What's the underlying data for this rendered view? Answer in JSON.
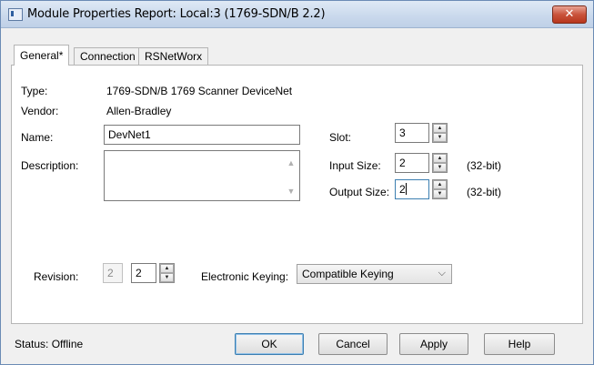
{
  "window": {
    "title": "Module Properties Report: Local:3 (1769-SDN/B 2.2)",
    "close_glyph": "✕"
  },
  "tabs": [
    {
      "label": "General*",
      "active": true
    },
    {
      "label": "Connection",
      "active": false
    },
    {
      "label": "RSNetWorx",
      "active": false
    }
  ],
  "general": {
    "type_label": "Type:",
    "type_value": "1769-SDN/B 1769 Scanner DeviceNet",
    "vendor_label": "Vendor:",
    "vendor_value": "Allen-Bradley",
    "name_label": "Name:",
    "name_value": "DevNet1",
    "description_label": "Description:",
    "description_value": "",
    "slot_label": "Slot:",
    "slot_value": "3",
    "input_size_label": "Input Size:",
    "input_size_value": "2",
    "input_size_unit": "(32-bit)",
    "output_size_label": "Output Size:",
    "output_size_value": "2",
    "output_size_unit": "(32-bit)",
    "revision_label": "Revision:",
    "revision_major": "2",
    "revision_minor": "2",
    "keying_label": "Electronic Keying:",
    "keying_value": "Compatible Keying"
  },
  "footer": {
    "status_label": "Status:",
    "status_value": "Offline",
    "buttons": {
      "ok": "OK",
      "cancel": "Cancel",
      "apply": "Apply",
      "help": "Help"
    }
  },
  "icons": {
    "up": "▲",
    "down": "▼",
    "chevron": "⌵"
  }
}
